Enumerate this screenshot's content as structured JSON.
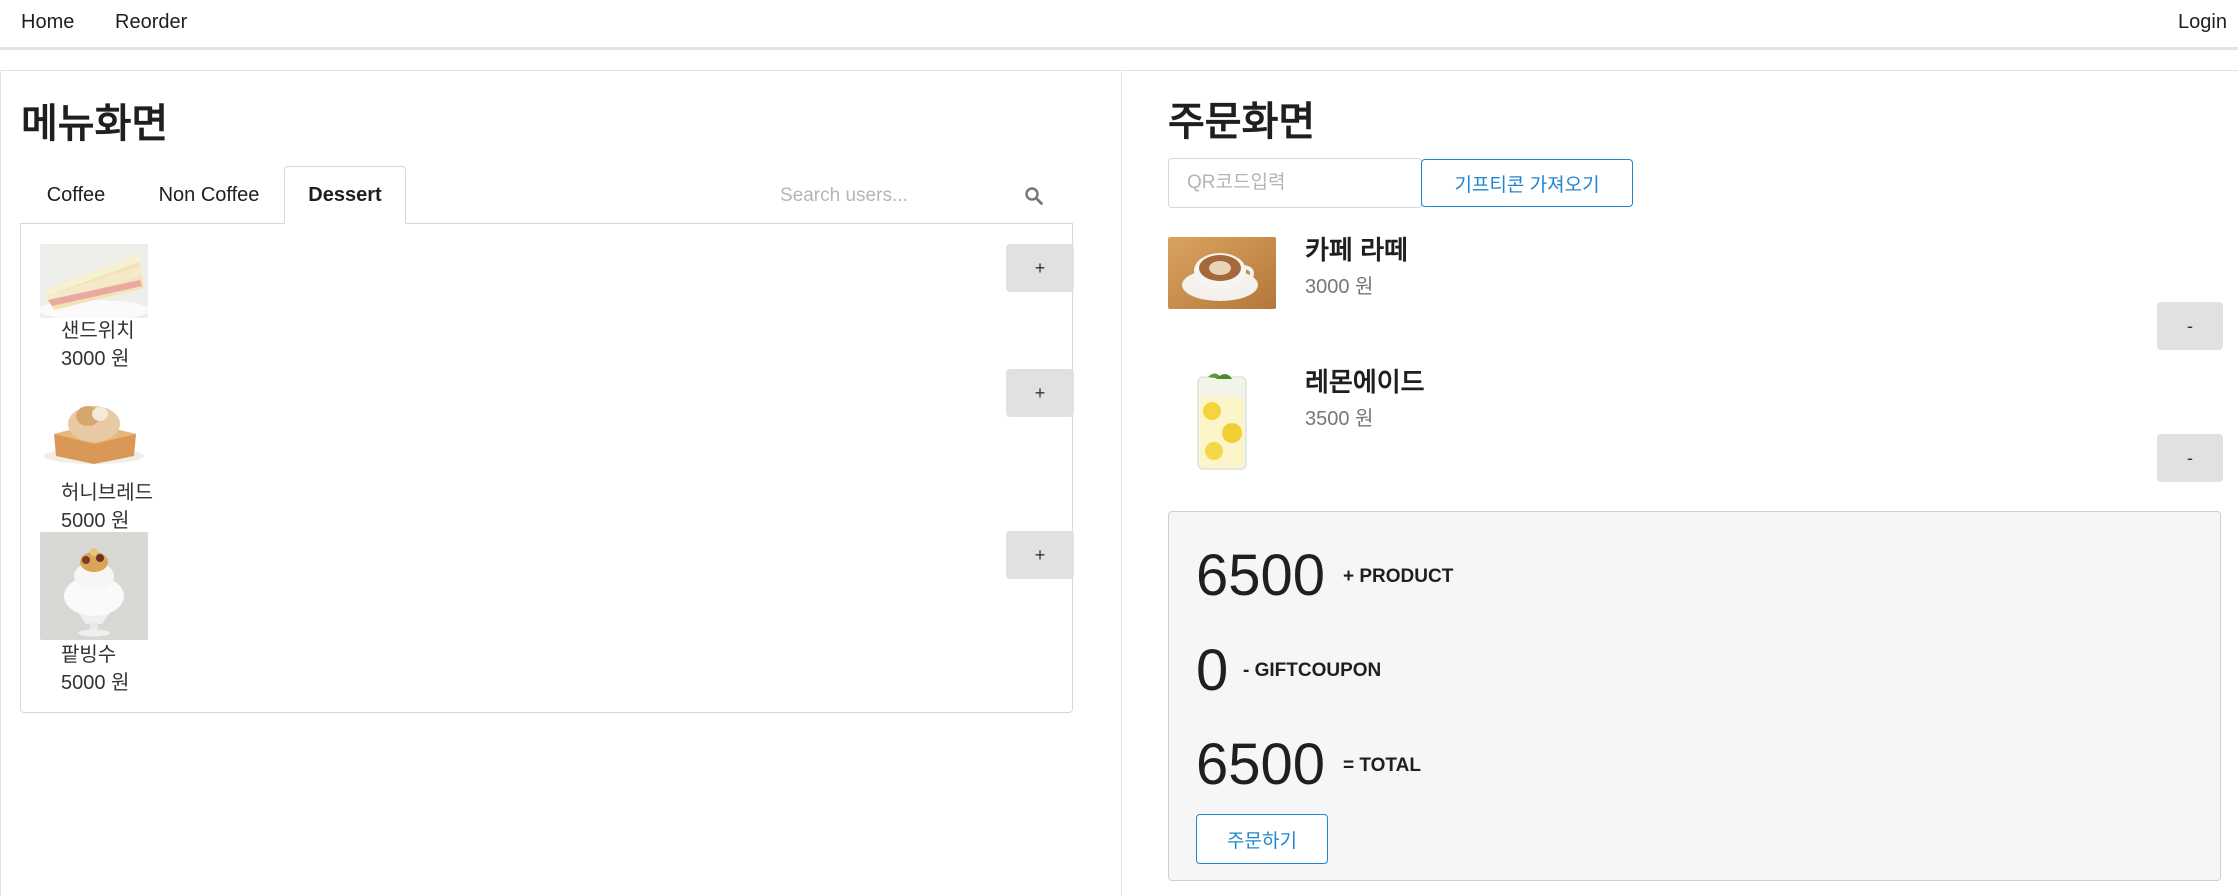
{
  "nav": {
    "home": "Home",
    "reorder": "Reorder",
    "login": "Login"
  },
  "menu": {
    "title": "메뉴화면",
    "tabs": [
      {
        "label": "Coffee"
      },
      {
        "label": "Non Coffee"
      },
      {
        "label": "Dessert",
        "active": true
      }
    ],
    "search_placeholder": "Search users...",
    "items": [
      {
        "name": "샌드위치",
        "price": "3000 원",
        "button": "+"
      },
      {
        "name": "허니브레드",
        "price": "5000 원",
        "button": "+"
      },
      {
        "name": "팥빙수",
        "price": "5000 원",
        "button": "+"
      }
    ]
  },
  "order": {
    "title": "주문화면",
    "qr_placeholder": "QR코드입력",
    "gift_button": "기프티콘 가져오기",
    "items": [
      {
        "name": "카페 라떼",
        "price": "3000 원",
        "button": "-"
      },
      {
        "name": "레몬에이드",
        "price": "3500 원",
        "button": "-"
      }
    ],
    "summary": {
      "product_value": "6500",
      "product_label": "+ PRODUCT",
      "coupon_value": "0",
      "coupon_label": "- GIFTCOUPON",
      "total_value": "6500",
      "total_label": "= TOTAL",
      "order_button": "주문하기"
    }
  },
  "colors": {
    "accent": "#2185d0",
    "button_gray": "#e1e1e1",
    "summary_bg": "#f6f6f6"
  }
}
